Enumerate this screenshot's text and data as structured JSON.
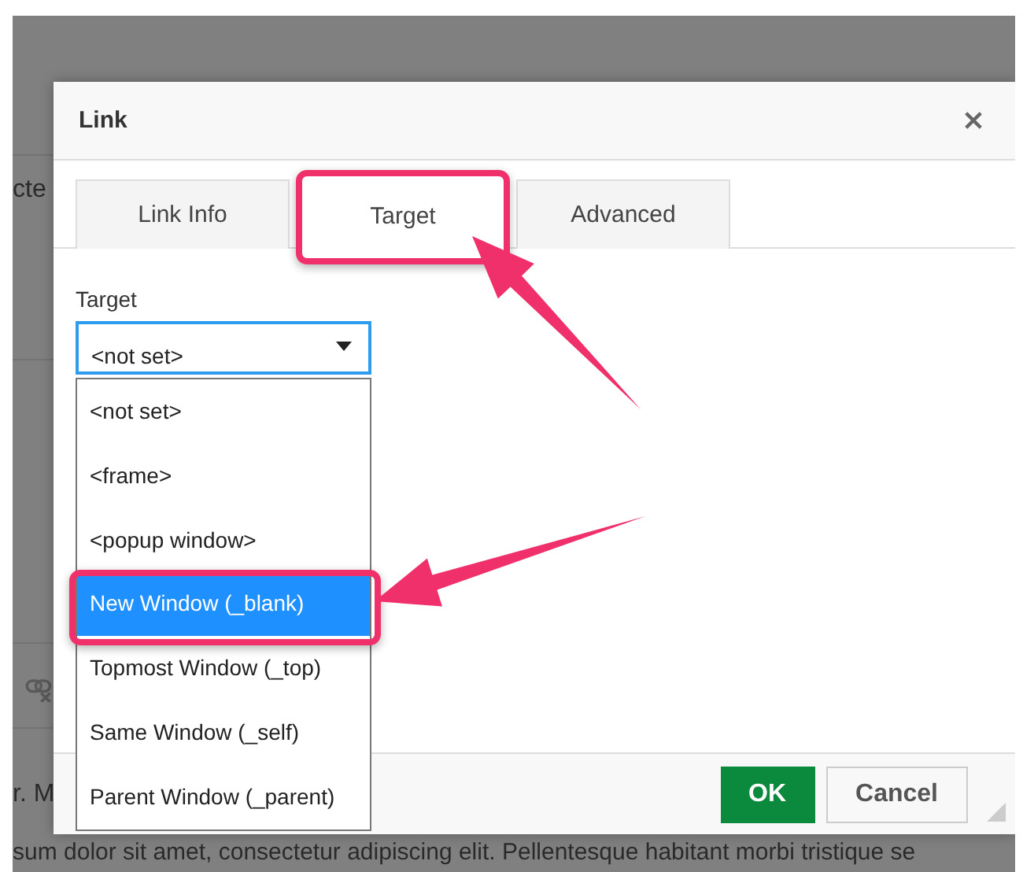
{
  "background": {
    "fragments": [
      "cte",
      "r. M"
    ],
    "text": "sum dolor sit amet, consectetur adipiscing elit. Pellentesque habitant morbi tristique se"
  },
  "dialog": {
    "title": "Link",
    "tabs": [
      {
        "label": "Link Info",
        "selected": false
      },
      {
        "label": "Target",
        "selected": true
      },
      {
        "label": "Advanced",
        "selected": false
      }
    ],
    "target_field": {
      "label": "Target",
      "value": "<not set>",
      "expanded": true
    },
    "options": [
      {
        "label": "<not set>",
        "selected": false
      },
      {
        "label": "<frame>",
        "selected": false
      },
      {
        "label": "<popup window>",
        "selected": false
      },
      {
        "label": "New Window (_blank)",
        "selected": true
      },
      {
        "label": "Topmost Window (_top)",
        "selected": false
      },
      {
        "label": "Same Window (_self)",
        "selected": false
      },
      {
        "label": "Parent Window (_parent)",
        "selected": false
      }
    ],
    "buttons": [
      {
        "label": "OK",
        "kind": "primary"
      },
      {
        "label": "Cancel",
        "kind": "secondary"
      }
    ]
  }
}
